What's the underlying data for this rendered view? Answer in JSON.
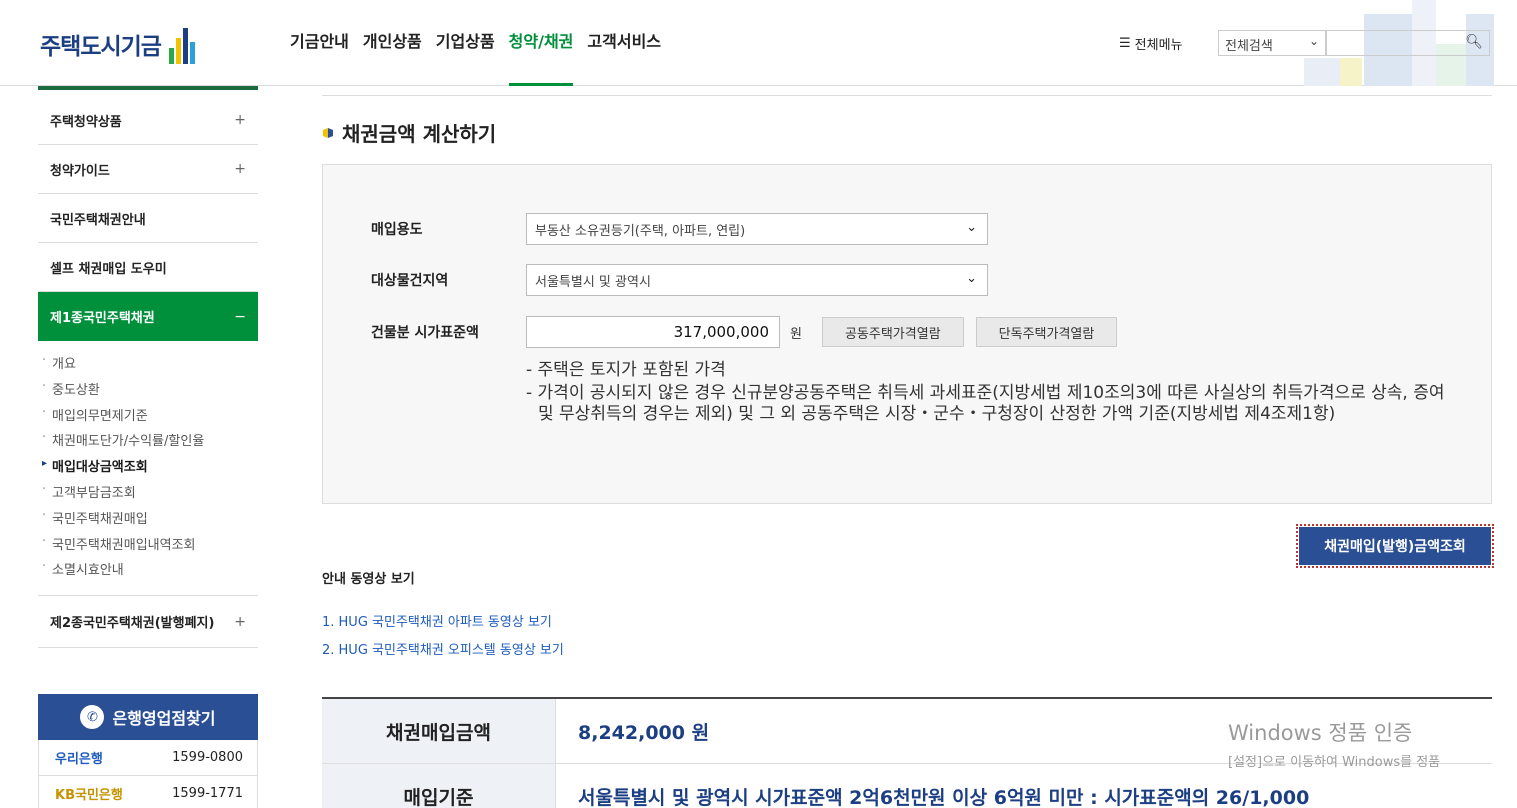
{
  "header": {
    "logo_text": "주택도시기금",
    "nav": [
      "기금안내",
      "개인상품",
      "기업상품",
      "청약/채권",
      "고객서비스"
    ],
    "active_nav": "청약/채권",
    "all_menu_label": "전체메뉴",
    "search_scope": "전체검색",
    "search_value": ""
  },
  "sidebar": {
    "items": [
      {
        "label": "주택청약상품",
        "toggle": "+"
      },
      {
        "label": "청약가이드",
        "toggle": "+"
      },
      {
        "label": "국민주택채권안내",
        "toggle": ""
      },
      {
        "label": "셀프 채권매입 도우미",
        "toggle": ""
      },
      {
        "label": "제1종국민주택채권",
        "toggle": "−"
      }
    ],
    "sub_items": [
      "개요",
      "중도상환",
      "매입의무면제기준",
      "채권매도단가/수익률/할인율",
      "매입대상금액조회",
      "고객부담금조회",
      "국민주택채권매입",
      "국민주택채권매입내역조회",
      "소멸시효안내"
    ],
    "current_sub": "매입대상금액조회",
    "item_after": {
      "label": "제2종국민주택채권(발행폐지)",
      "toggle": "+"
    }
  },
  "branch": {
    "title": "은행영업점찾기",
    "banks": [
      {
        "name": "우리은행",
        "phone": "1599-0800"
      },
      {
        "name": "KB국민은행",
        "phone": "1599-1771"
      }
    ]
  },
  "main": {
    "title": "채권금액 계산하기",
    "form": {
      "purpose_label": "매입용도",
      "purpose_value": "부동산 소유권등기(주택, 아파트, 연립)",
      "region_label": "대상물건지역",
      "region_value": "서울특별시 및 광역시",
      "price_label": "건물분 시가표준액",
      "price_value": "317,000,000",
      "price_unit": "원",
      "btn_apt": "공동주택가격열람",
      "btn_house": "단독주택가격열람"
    },
    "notes": [
      "- 주택은 토지가 포함된 가격",
      "- 가격이 공시되지 않은 경우 신규분양공동주택은 취득세 과세표준(지방세법 제10조의3에 따른 사실상의 취득가격으로 상속, 증여 및 무상취득의 경우는 제외) 및 그 외 공동주택은 시장・군수・구청장이 산정한 가액 기준(지방세법 제4조제1항)"
    ],
    "submit_label": "채권매입(발행)금액조회",
    "video_title": "안내 동영상 보기",
    "video_links": [
      "1. HUG 국민주택채권 아파트 동영상 보기",
      "2. HUG 국민주택채권 오피스텔 동영상 보기"
    ],
    "result": {
      "amount_label": "채권매입금액",
      "amount_value": "8,242,000 원",
      "basis_label": "매입기준",
      "basis_value": "서울특별시 및 광역시 시가표준액 2억6천만원 이상 6억원 미만 : 시가표준액의 26/1,000"
    }
  },
  "watermark": {
    "title": "Windows 정품 인증",
    "subtitle": "[설정]으로 이동하여 Windows를 정품"
  },
  "colors": {
    "accent_green": "#00903c",
    "brand_navy": "#1c3e82",
    "button_blue": "#2a4f95"
  }
}
